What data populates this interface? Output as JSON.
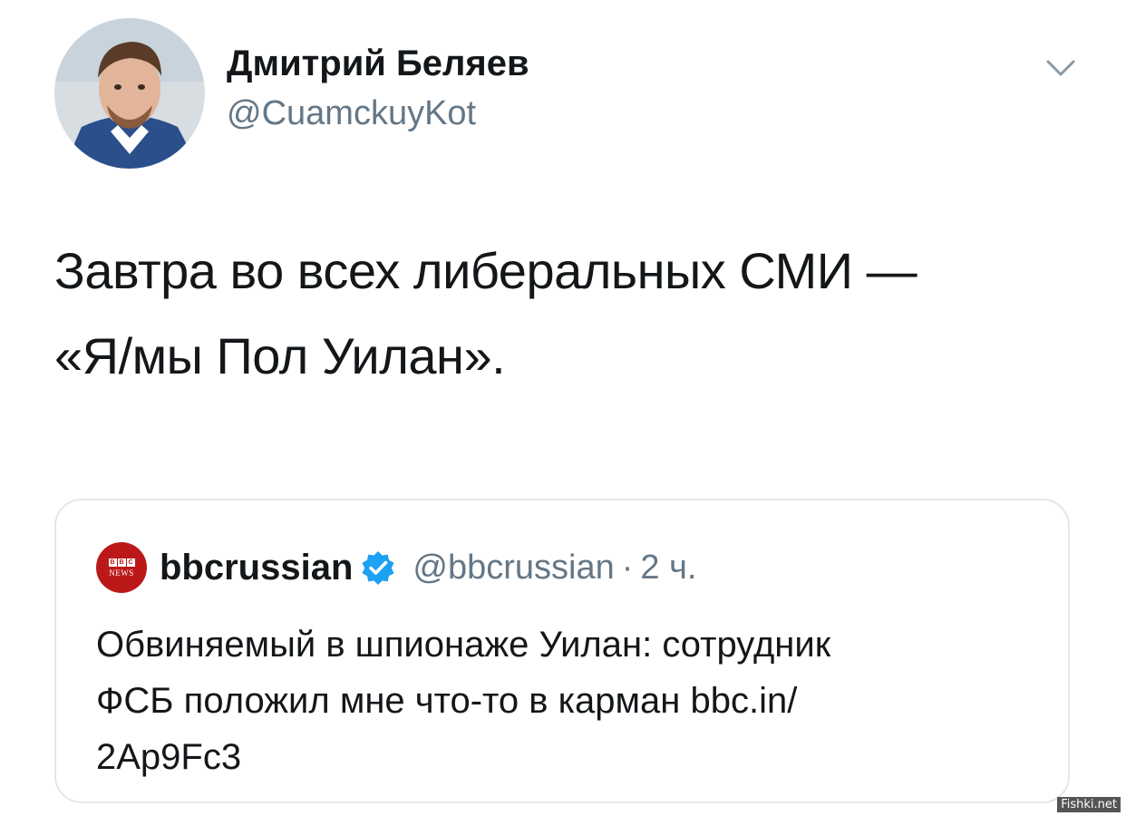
{
  "author": {
    "display_name": "Дмитрий Беляев",
    "handle": "@CuamckuyKot",
    "avatar_icon": "user-avatar-photo"
  },
  "tweet": {
    "lines": [
      "Завтра во всех либеральных СМИ —",
      "«Я/мы Пол Уилан»."
    ]
  },
  "menu": {
    "icon": "chevron-down-icon"
  },
  "quoted_tweet": {
    "logo": {
      "boxes": [
        "B",
        "B",
        "C"
      ],
      "text": "NEWS"
    },
    "display_name": "bbcrussian",
    "verified_icon": "verified-badge-icon",
    "handle": "@bbcrussian",
    "separator": "·",
    "time": "2 ч.",
    "lines": [
      "Обвиняемый в шпионаже Уилан: сотрудник",
      "ФСБ положил мне что-то в карман bbc.in/",
      "2Ap9Fc3"
    ]
  },
  "watermark": "Fishki.net",
  "colors": {
    "text": "#14171a",
    "secondary": "#657786",
    "border": "#e1e8ed",
    "verified": "#1da1f2",
    "bbc_red": "#bb1919"
  }
}
